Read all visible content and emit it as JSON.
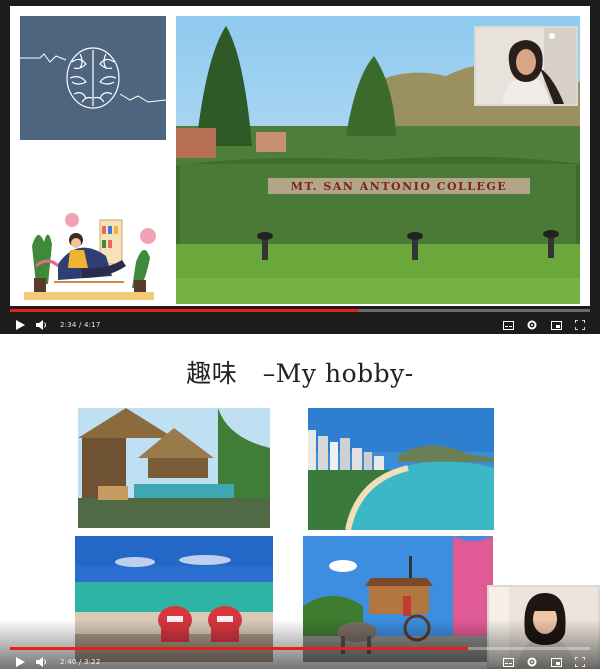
{
  "players": [
    {
      "current_time": "2:34",
      "duration": "4:17",
      "progress_fraction": 0.6,
      "slide": {
        "sign_text": "MT. SAN ANTONIO COLLEGE"
      }
    },
    {
      "current_time": "2:40",
      "duration": "3:22",
      "progress_fraction": 0.79,
      "slide": {
        "title": "趣味　–My hobby-"
      }
    }
  ],
  "colors": {
    "progress_fill": "#e62117",
    "brain_card": "#4e6580"
  },
  "icons": [
    "play-icon",
    "volume-icon",
    "subtitles-icon",
    "settings-icon",
    "miniplayer-icon",
    "fullscreen-icon"
  ]
}
